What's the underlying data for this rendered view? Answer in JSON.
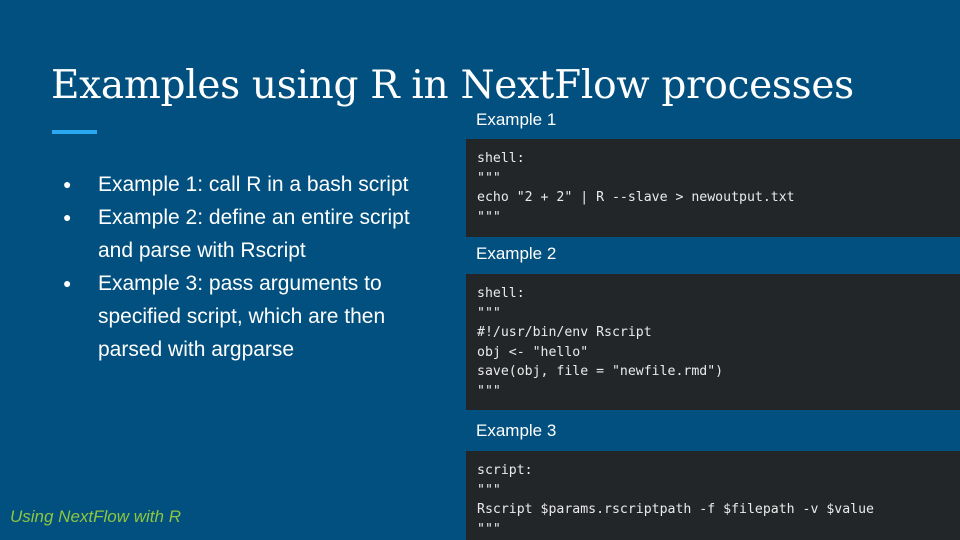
{
  "slide": {
    "title": "Examples using R in NextFlow processes",
    "bullets": [
      "Example 1: call R in a bash script",
      "Example 2: define an entire script and parse with Rscript",
      "Example 3: pass arguments to specified script, which are then parsed with argparse"
    ],
    "bullet_glyph": "●",
    "examples": [
      {
        "label": "Example 1",
        "code": [
          "shell:",
          "\"\"\"",
          "echo \"2 + 2\" | R --slave > newoutput.txt",
          "\"\"\""
        ]
      },
      {
        "label": "Example 2",
        "code": [
          "shell:",
          "\"\"\"",
          "#!/usr/bin/env Rscript",
          "obj <- \"hello\"",
          "save(obj, file = \"newfile.rmd\")",
          "\"\"\""
        ]
      },
      {
        "label": "Example 3",
        "code": [
          "script:",
          "\"\"\"",
          "Rscript $params.rscriptpath -f $filepath -v $value",
          "\"\"\""
        ]
      }
    ],
    "footer": "Using NextFlow with R"
  },
  "colors": {
    "background": "#01507f",
    "accent": "#2aa8f2",
    "code_background": "#232629",
    "footer_text": "#8dc63f"
  }
}
